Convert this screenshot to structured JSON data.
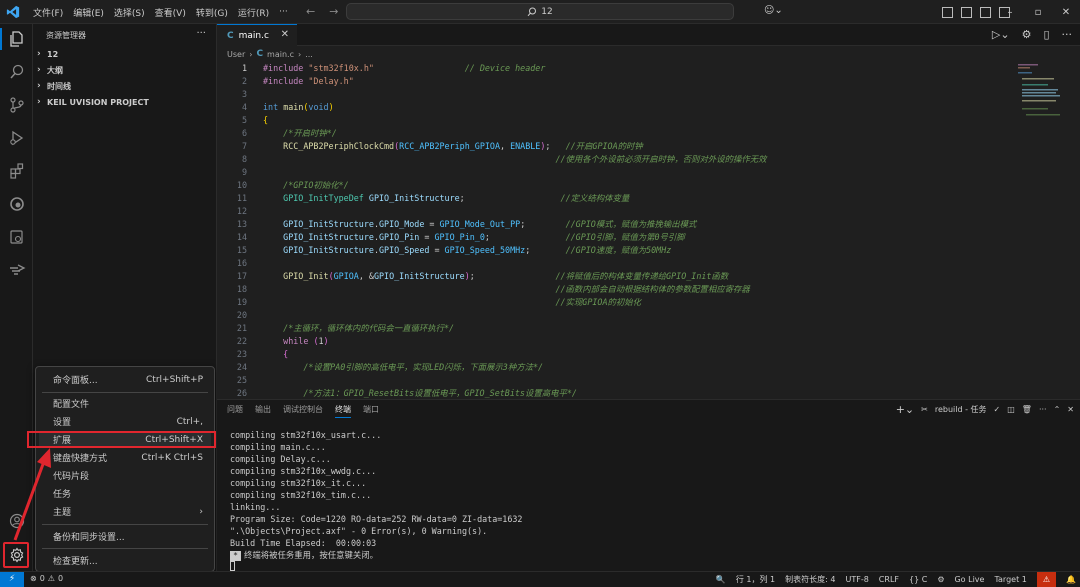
{
  "menubar": {
    "items": [
      "文件(F)",
      "编辑(E)",
      "选择(S)",
      "查看(V)",
      "转到(G)",
      "运行(R)"
    ],
    "more": "···"
  },
  "search": {
    "text": "12"
  },
  "sidebar": {
    "title": "资源管理器",
    "more": "···",
    "sections": [
      "12",
      "大纲",
      "时间线",
      "KEIL UVISION PROJECT"
    ]
  },
  "context_menu": {
    "items": [
      {
        "label": "命令面板...",
        "shortcut": "Ctrl+Shift+P"
      },
      {
        "label": "配置文件",
        "shortcut": ""
      },
      {
        "label": "设置",
        "shortcut": "Ctrl+,"
      },
      {
        "label": "扩展",
        "shortcut": "Ctrl+Shift+X"
      },
      {
        "label": "键盘快捷方式",
        "shortcut": "Ctrl+K Ctrl+S"
      },
      {
        "label": "代码片段",
        "shortcut": ""
      },
      {
        "label": "任务",
        "shortcut": ""
      },
      {
        "label": "主题",
        "shortcut": "›"
      },
      {
        "label": "备份和同步设置...",
        "shortcut": ""
      },
      {
        "label": "检查更新...",
        "shortcut": ""
      }
    ]
  },
  "editor": {
    "tab": "main.c",
    "breadcrumb": [
      "User",
      "›",
      "main.c",
      "›",
      "..."
    ],
    "line_numbers": [
      "1",
      "2",
      "3",
      "4",
      "5",
      "6",
      "7",
      "8",
      "9",
      "10",
      "11",
      "12",
      "13",
      "14",
      "15",
      "16",
      "17",
      "18",
      "19",
      "20",
      "21",
      "22",
      "23",
      "24",
      "25",
      "26"
    ],
    "comments": {
      "l1": "// Device header",
      "l6": "/*开启时钟*/",
      "l7": "//开启GPIOA的时钟",
      "l8": "//使用各个外设前必须开启时钟，否则对外设的操作无效",
      "l10": "/*GPIO初始化*/",
      "l11": "//定义结构体变量",
      "l13": "//GPIO模式，赋值为推挽输出模式",
      "l14": "//GPIO引脚，赋值为第0号引脚",
      "l15": "//GPIO速度，赋值为50MHz",
      "l17": "//将赋值后的构体变量传递给GPIO_Init函数",
      "l18": "//函数内部会自动根据结构体的参数配置相应寄存器",
      "l19": "//实现GPIOA的初始化",
      "l21": "/*主循环，循环体内的代码会一直循环执行*/",
      "l24": "/*设置PA0引脚的高低电平，实现LED闪烁，下面展示3种方法*/",
      "l26": "/*方法1：GPIO_ResetBits设置低电平，GPIO_SetBits设置高电平*/"
    }
  },
  "panel": {
    "tabs": [
      "问题",
      "输出",
      "调试控制台",
      "终端",
      "端口"
    ],
    "task": "rebuild - 任务",
    "terminal_lines": [
      "compiling stm32f10x_usart.c...",
      "compiling main.c...",
      "compiling Delay.c...",
      "compiling stm32f10x_wwdg.c...",
      "compiling stm32f10x_it.c...",
      "compiling stm32f10x_tim.c...",
      "linking...",
      "Program Size: Code=1220 RO-data=252 RW-data=0 ZI-data=1632",
      "\".\\Objects\\Project.axf\" - 0 Error(s), 0 Warning(s).",
      "Build Time Elapsed:  00:00:03"
    ],
    "terminal_end": "终端将被任务重用，按任意键关闭。"
  },
  "statusbar": {
    "errors": "0",
    "warnings": "0",
    "position": "行 1，列 1",
    "tab_size": "制表符长度: 4",
    "encoding": "UTF-8",
    "eol": "CRLF",
    "lang": "{} C",
    "golive": "Go Live",
    "target": "Target 1"
  },
  "colors": {
    "accent": "#0078d4",
    "highlight": "#e0262e"
  }
}
